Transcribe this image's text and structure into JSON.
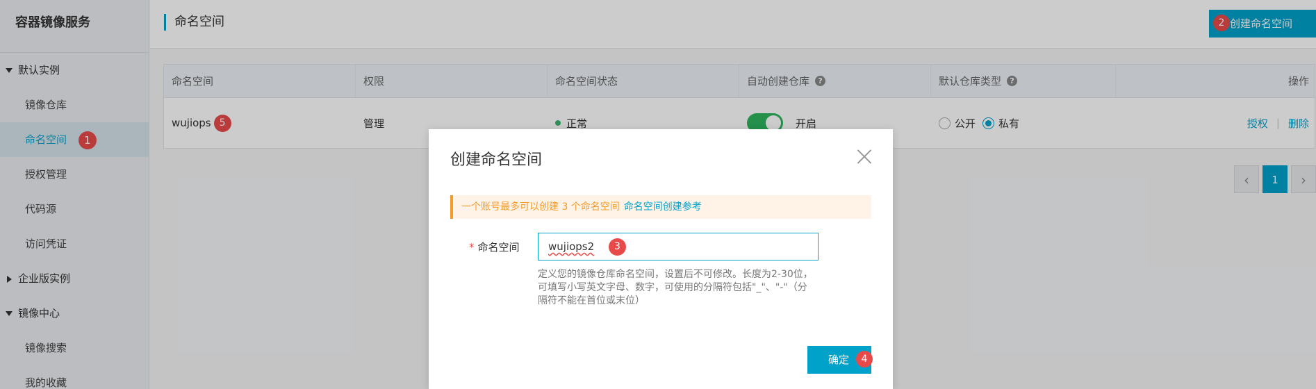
{
  "sidebar": {
    "brand": "容器镜像服务",
    "groups": [
      {
        "label": "默认实例"
      },
      {
        "label": "企业版实例"
      },
      {
        "label": "镜像中心"
      }
    ],
    "items": [
      {
        "label": "镜像仓库"
      },
      {
        "label": "命名空间",
        "badge": "1"
      },
      {
        "label": "授权管理"
      },
      {
        "label": "代码源"
      },
      {
        "label": "访问凭证"
      },
      {
        "label": "镜像搜索"
      },
      {
        "label": "我的收藏"
      }
    ]
  },
  "header": {
    "title": "命名空间",
    "create_button": "创建命名空间",
    "create_badge": "2"
  },
  "table": {
    "columns": [
      "命名空间",
      "权限",
      "命名空间状态",
      "自动创建仓库",
      "默认仓库类型",
      "操作"
    ],
    "help_icon": "?",
    "row": {
      "name": "wujiops",
      "name_badge": "5",
      "permission": "管理",
      "status": "正常",
      "auto_create": "开启",
      "repo_type_public": "公开",
      "repo_type_private": "私有",
      "action_authorize": "授权",
      "action_separator": "|",
      "action_delete": "删除"
    }
  },
  "pagination": {
    "prev": "‹",
    "current": "1",
    "next": "›"
  },
  "modal": {
    "title": "创建命名空间",
    "notice": "一个账号最多可以创建 3 个命名空间",
    "notice_link": "命名空间创建参考",
    "field_required_mark": "*",
    "field_label": "命名空间",
    "field_value": "wujiops2",
    "field_badge": "3",
    "field_help": "定义您的镜像仓库命名空间，设置后不可修改。长度为2-30位，可填写小写英文字母、数字，可使用的分隔符包括\"_\"、\"-\"（分隔符不能在首位或末位）",
    "ok_button": "确定",
    "ok_badge": "4"
  },
  "colors": {
    "accent": "#00a2ca",
    "badge": "#e84a4a",
    "notice": "#f39c2b",
    "toggle_on": "#2db55d"
  }
}
